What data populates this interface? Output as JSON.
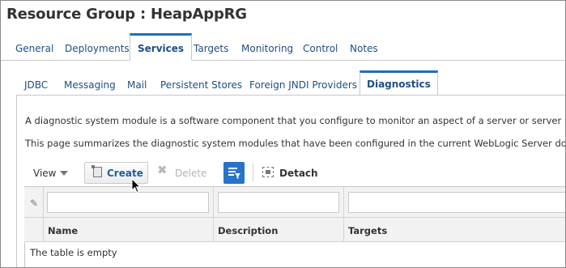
{
  "page_title": "Resource Group : HeapAppRG",
  "primary_tabs": [
    {
      "label": "General",
      "active": false
    },
    {
      "label": "Deployments",
      "active": false
    },
    {
      "label": "Services",
      "active": true
    },
    {
      "label": "Targets",
      "active": false
    },
    {
      "label": "Monitoring",
      "active": false
    },
    {
      "label": "Control",
      "active": false
    },
    {
      "label": "Notes",
      "active": false
    }
  ],
  "secondary_tabs": [
    {
      "label": "JDBC",
      "active": false
    },
    {
      "label": "Messaging",
      "active": false
    },
    {
      "label": "Mail",
      "active": false
    },
    {
      "label": "Persistent Stores",
      "active": false
    },
    {
      "label": "Foreign JNDI Providers",
      "active": false
    },
    {
      "label": "Diagnostics",
      "active": true
    }
  ],
  "description": {
    "line1": "A diagnostic system module is a software component that you configure to monitor an aspect of a server or server resource.",
    "line2": "This page summarizes the diagnostic system modules that have been configured in the current WebLogic Server domain."
  },
  "toolbar": {
    "view_label": "View",
    "create_label": "Create",
    "delete_label": "Delete",
    "detach_label": "Detach"
  },
  "table": {
    "columns": [
      "Name",
      "Description",
      "Targets"
    ],
    "empty_message": "The table is empty"
  },
  "colors": {
    "accent": "#1f6fb8",
    "link": "#1f4e85",
    "filter_button": "#2673c8"
  }
}
